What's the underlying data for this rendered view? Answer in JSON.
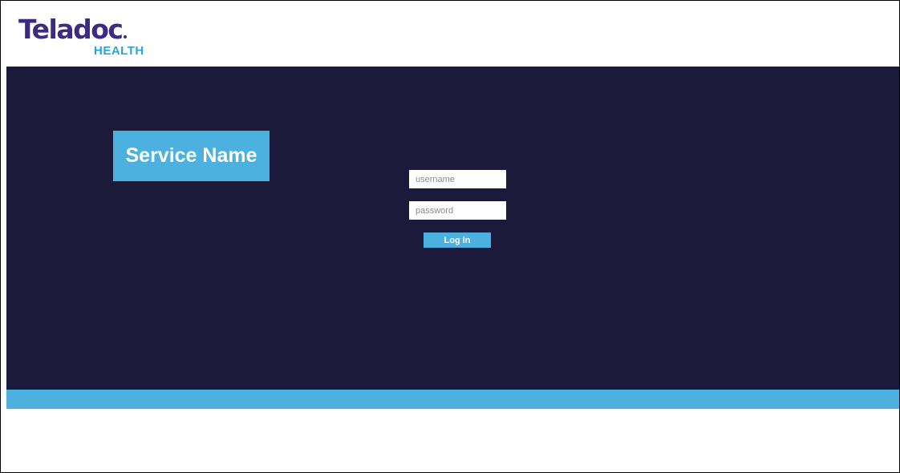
{
  "brand": {
    "name": "Teladoc",
    "sub": "HEALTH",
    "primary_color": "#3d2b82",
    "accent_color": "#2aa3db"
  },
  "hero": {
    "background_color": "#1b1a3b",
    "service_name": "Service Name",
    "badge_color": "#4db1df"
  },
  "login": {
    "username_placeholder": "username",
    "password_placeholder": "password",
    "button_label": "Log In"
  },
  "footer": {
    "bar_color": "#4db1df"
  }
}
